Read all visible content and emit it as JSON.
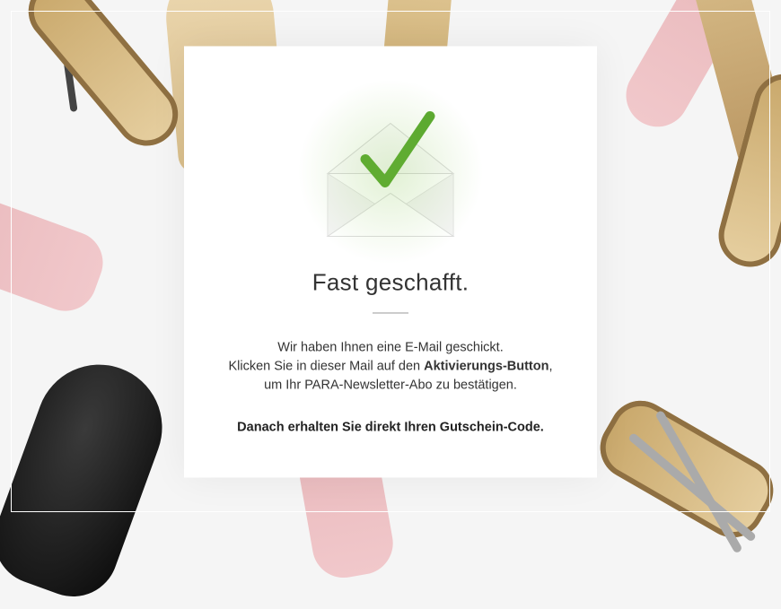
{
  "modal": {
    "title": "Fast geschafft.",
    "line1": "Wir haben Ihnen eine E-Mail geschickt.",
    "line2_prefix": "Klicken Sie in dieser Mail auf den ",
    "line2_bold": "Aktivierungs-Button",
    "line2_suffix": ",",
    "line3": "um Ihr PARA-Newsletter-Abo zu bestätigen.",
    "coupon_line": "Danach erhalten Sie direkt Ihren Gutschein-Code."
  },
  "icons": {
    "envelope": "envelope-checkmark-icon"
  },
  "colors": {
    "checkmark": "#5aa82f"
  }
}
